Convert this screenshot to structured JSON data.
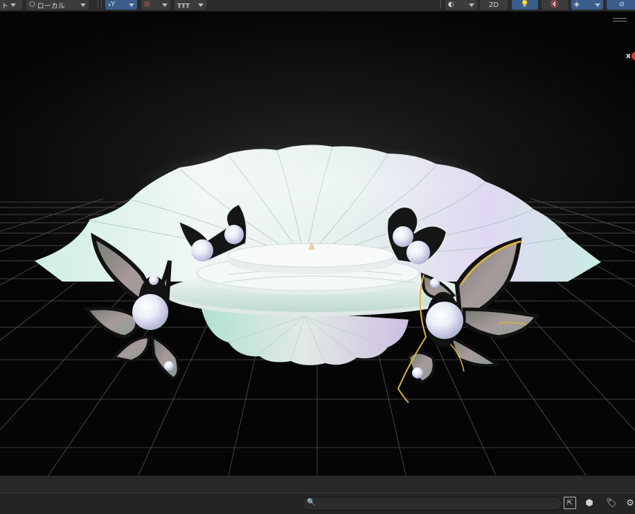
{
  "toolbar": {
    "tool_handle": {
      "label": "ト",
      "icon": "dropdown-icon"
    },
    "pivot_space": {
      "label": "ローカル",
      "icon": "local-space-icon"
    },
    "move_tool": {
      "label": "₄Y",
      "icon": "move-tool-icon",
      "active": true
    },
    "snap_tool": {
      "icon": "snap-increment-icon"
    },
    "grid_tool": {
      "icon": "grid-snapping-icon"
    },
    "shading_mode": {
      "icon": "shading-mode-icon"
    },
    "view_2d": {
      "label": "2D"
    },
    "lighting": {
      "icon": "lighting-icon",
      "active": true
    },
    "audio": {
      "label": "🔇"
    },
    "effects": {
      "icon": "effects-layers-icon",
      "active": true
    },
    "visibility": {
      "icon": "hidden-objects-icon",
      "active": true
    }
  },
  "viewport": {
    "overlay_menu_icon": "menu-lines-icon",
    "gizmo_axis_label": "x",
    "scene_object": "pearl-shell-stage",
    "colors": {
      "background": "#050505",
      "grid": "#6b6b6b",
      "shell_light": "#eaf6f2",
      "shell_tint_a": "#bfeadf",
      "shell_tint_b": "#d6c9ef",
      "wing_dark": "#151515",
      "gold_outline": "#e0b43a"
    }
  },
  "statusbar": {
    "search_placeholder": "",
    "search_value": "",
    "icons": [
      "open-window-icon",
      "scene-visibility-icon",
      "tag-icon",
      "settings-icon"
    ]
  }
}
